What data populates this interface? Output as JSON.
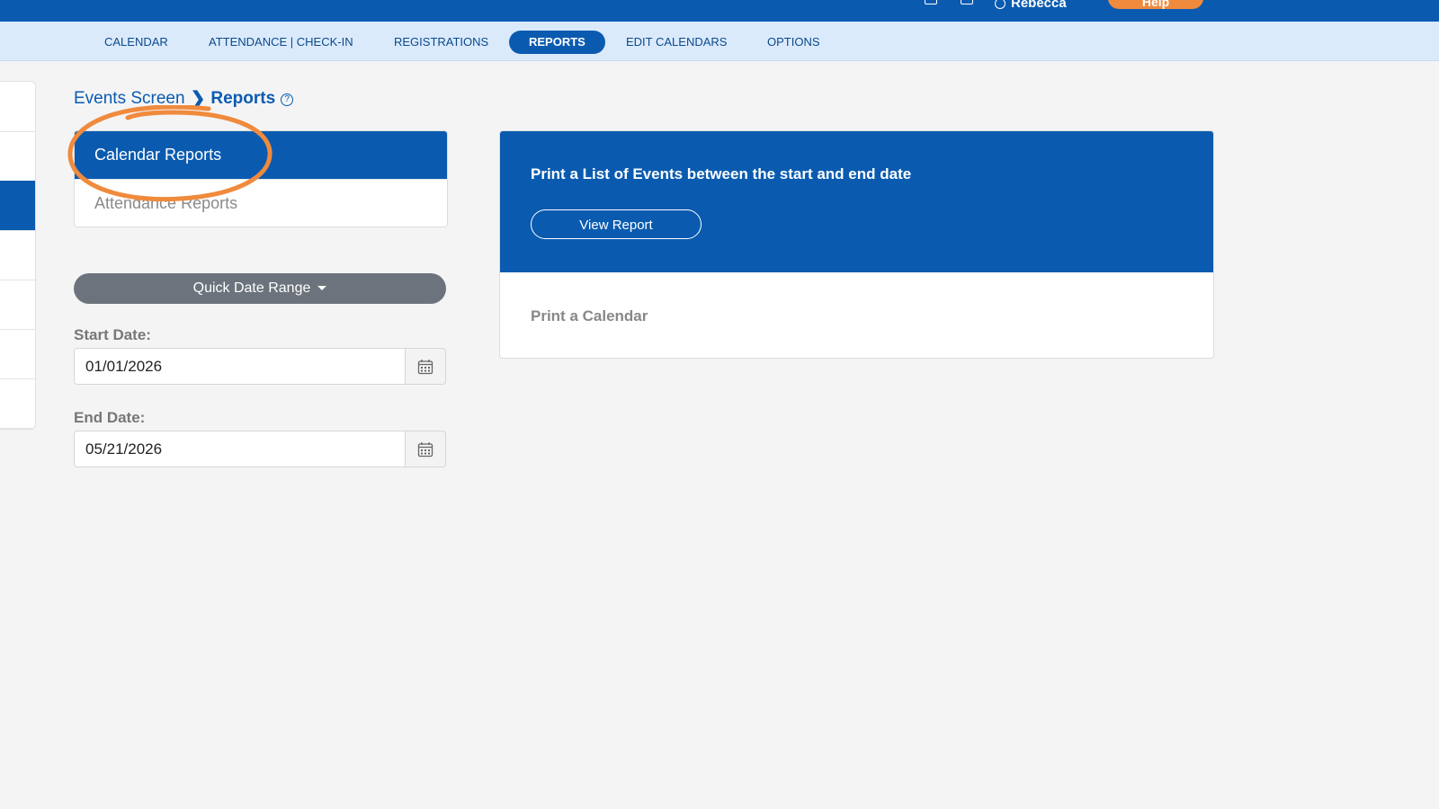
{
  "topbar": {
    "user_name": "Rebecca",
    "help_label": "Help",
    "icons": [
      "calendar-icon",
      "monitor-icon",
      "user-icon"
    ]
  },
  "nav": {
    "items": [
      {
        "label": "CALENDAR"
      },
      {
        "label": "ATTENDANCE | CHECK-IN"
      },
      {
        "label": "REGISTRATIONS"
      },
      {
        "label": "REPORTS"
      },
      {
        "label": "EDIT CALENDARS"
      },
      {
        "label": "OPTIONS"
      }
    ],
    "active": "REPORTS"
  },
  "breadcrumb": {
    "parent": "Events Screen",
    "separator": "❯",
    "current": "Reports",
    "help": "?"
  },
  "report_types": {
    "items": [
      "Calendar Reports",
      "Attendance Reports"
    ],
    "selected": "Calendar Reports"
  },
  "quick_date_range": {
    "label": "Quick Date Range"
  },
  "start_date": {
    "label": "Start Date:",
    "value": "01/01/2026"
  },
  "end_date": {
    "label": "End Date:",
    "value": "05/21/2026"
  },
  "reports": {
    "list_heading": "Print a List of Events between the start and end date",
    "view_button": "View Report",
    "calendar_heading": "Print a Calendar"
  },
  "colors": {
    "brand_blue": "#0a5bb0",
    "nav_bg": "#dbeafb",
    "annotation_orange": "#f08a3c",
    "button_gray": "#6c737c"
  }
}
